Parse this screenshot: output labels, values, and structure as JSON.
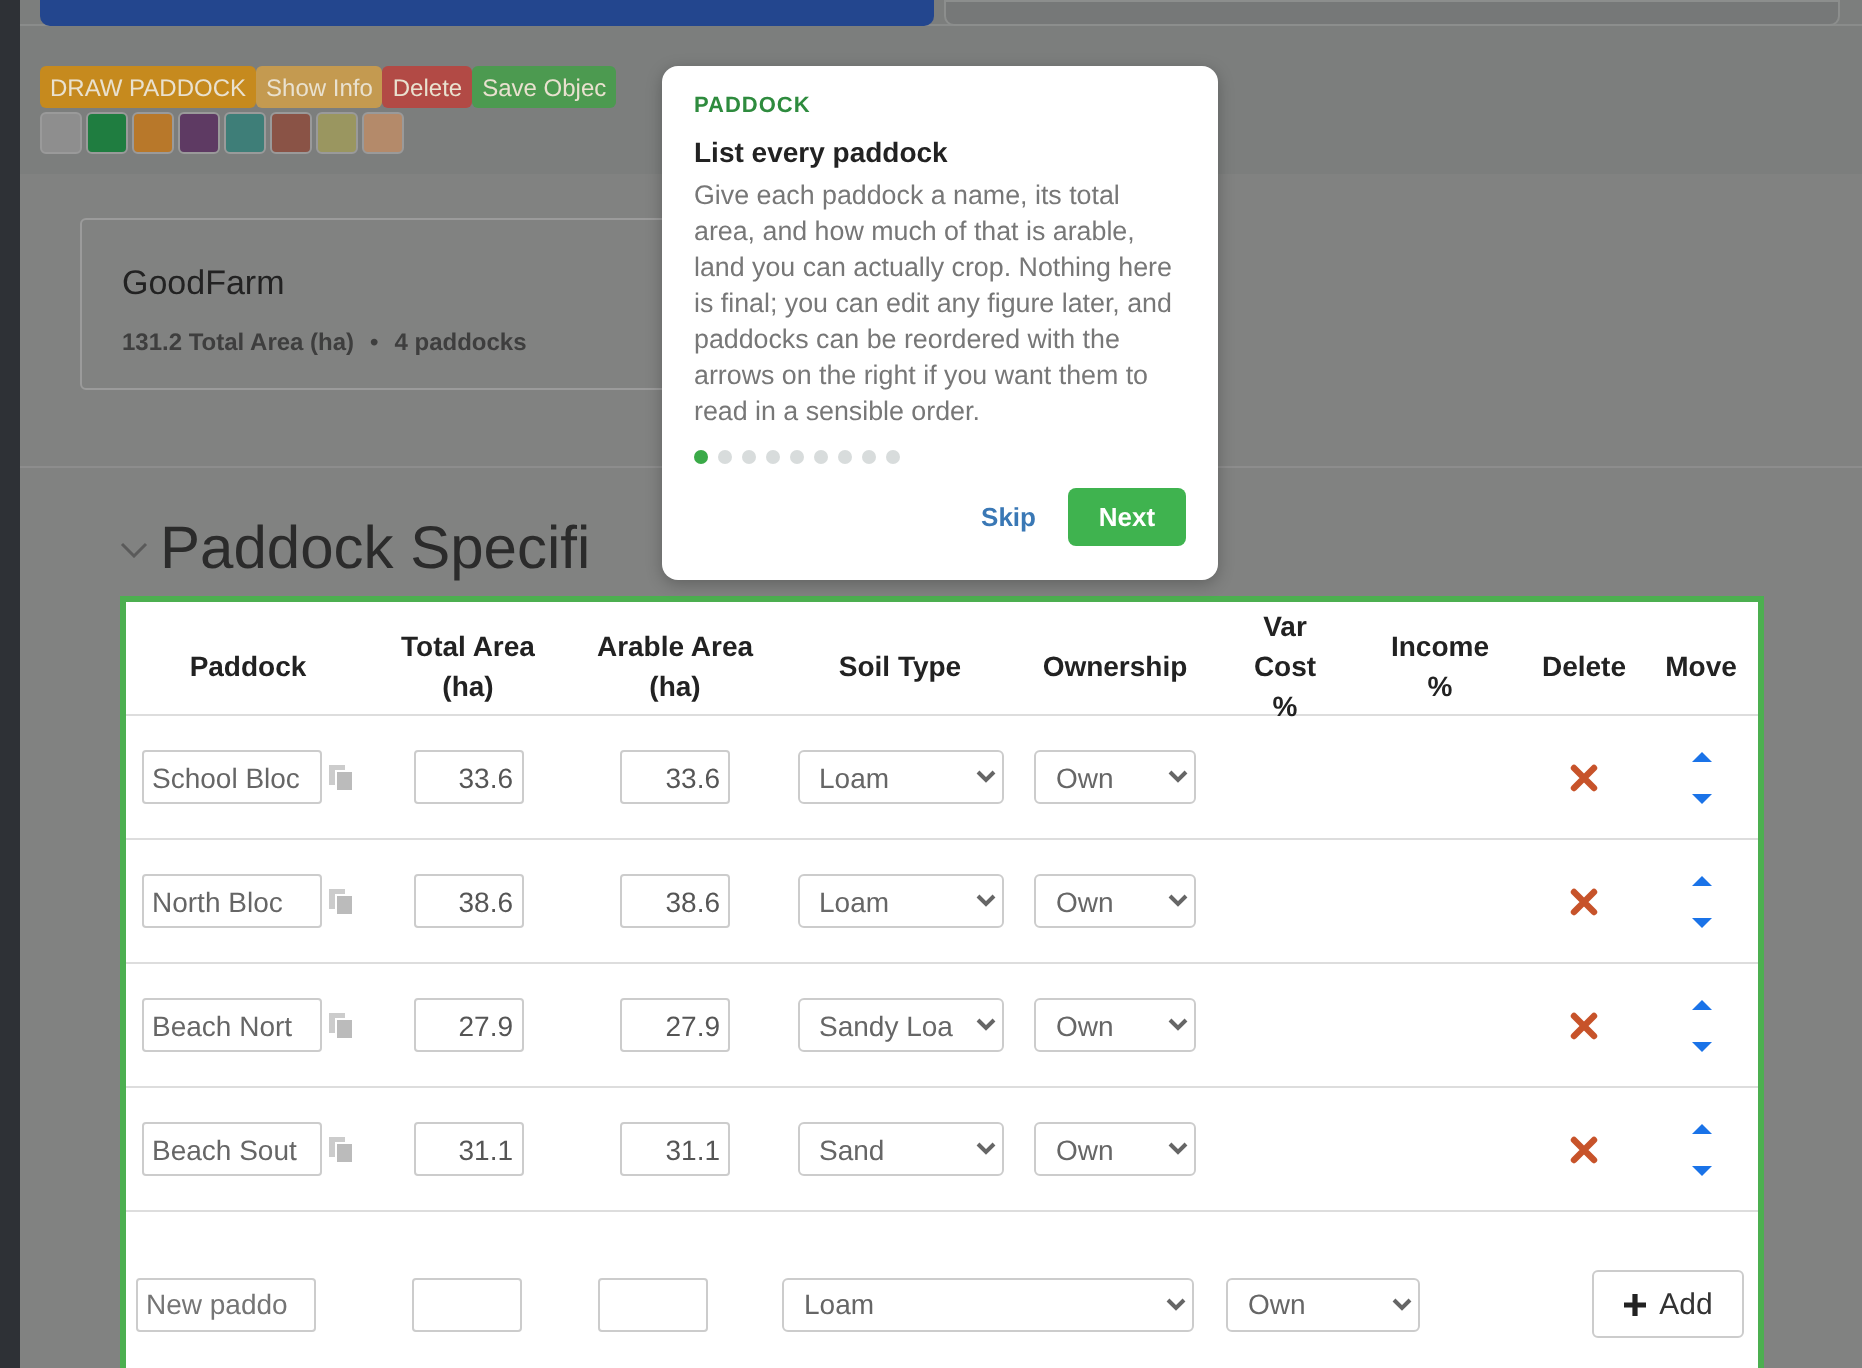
{
  "top_buttons": [
    {
      "kind": "primary"
    },
    {
      "kind": "secondary"
    }
  ],
  "toolbar": [
    {
      "label": "DRAW PADDOCK",
      "color": "#c68a1e"
    },
    {
      "label": "Show Info",
      "color": "#c49a50"
    },
    {
      "label": "Delete",
      "color": "#b24a45"
    },
    {
      "label": "Save Objec",
      "color": "#4c9a50"
    }
  ],
  "swatches": [
    {
      "color": "#8e8e8e"
    },
    {
      "color": "#1f7d40"
    },
    {
      "color": "#b8782a"
    },
    {
      "color": "#5e3a63"
    },
    {
      "color": "#3e7e78"
    },
    {
      "color": "#8a5346"
    },
    {
      "color": "#9a9660"
    },
    {
      "color": "#b48a6a"
    }
  ],
  "farm": {
    "name": "GoodFarm",
    "total_area": "131.2 Total Area (ha)",
    "separator": "•",
    "paddock_count": "4 paddocks"
  },
  "section": {
    "title": "Paddock Specifi",
    "expanded": true
  },
  "table": {
    "columns": [
      "Paddock",
      "Total Area (ha)",
      "Arable Area (ha)",
      "Soil Type",
      "Ownership",
      "Var Cost %",
      "Income %",
      "Delete",
      "Move"
    ],
    "rows": [
      {
        "name": "School Bloc",
        "total": "33.6",
        "arable": "33.6",
        "soil": "Loam",
        "ownership": "Own"
      },
      {
        "name": "North Bloc",
        "total": "38.6",
        "arable": "38.6",
        "soil": "Loam",
        "ownership": "Own"
      },
      {
        "name": "Beach Nort",
        "total": "27.9",
        "arable": "27.9",
        "soil": "Sandy Loa",
        "ownership": "Own"
      },
      {
        "name": "Beach Sout",
        "total": "31.1",
        "arable": "31.1",
        "soil": "Sand",
        "ownership": "Own"
      }
    ],
    "new_row": {
      "placeholder": "New paddo",
      "soil": "Loam",
      "ownership": "Own",
      "add": "Add"
    }
  },
  "tour": {
    "category": "PADDOCK",
    "title": "List every paddock",
    "body": "Give each paddock a name, its total area, and how much of that is arable, land you can actually crop. Nothing here is final; you can edit any figure later, and paddocks can be reordered with the arrows on the right if you want them to read in a sensible order.",
    "steps": [
      {
        "selected": true
      },
      {
        "selected": false
      },
      {
        "selected": false
      },
      {
        "selected": false
      },
      {
        "selected": false
      },
      {
        "selected": false
      },
      {
        "selected": false
      },
      {
        "selected": false
      },
      {
        "selected": false
      }
    ],
    "skip": "Skip",
    "next": "Next"
  }
}
